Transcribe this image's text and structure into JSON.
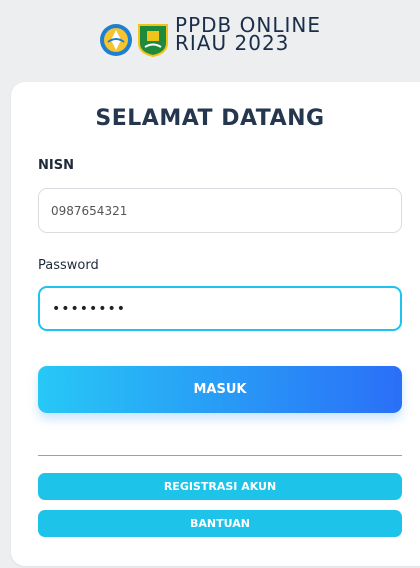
{
  "header": {
    "brand_line1": "PPDB ONLINE",
    "brand_line2": "RIAU 2023",
    "logo_left": "tut-wuri-handayani-logo",
    "logo_right": "riau-province-emblem"
  },
  "login": {
    "title": "SELAMAT DATANG",
    "nisn_label": "NISN",
    "nisn_value": "0987654321",
    "password_label": "Password",
    "password_value": "********",
    "submit_label": "MASUK"
  },
  "links": {
    "register_label": "REGISTRASI AKUN",
    "help_label": "BANTUAN"
  },
  "colors": {
    "accent": "#1ec3ea",
    "gradient_start": "#27c8f6",
    "gradient_end": "#2a6ff7",
    "title": "#25364f"
  }
}
